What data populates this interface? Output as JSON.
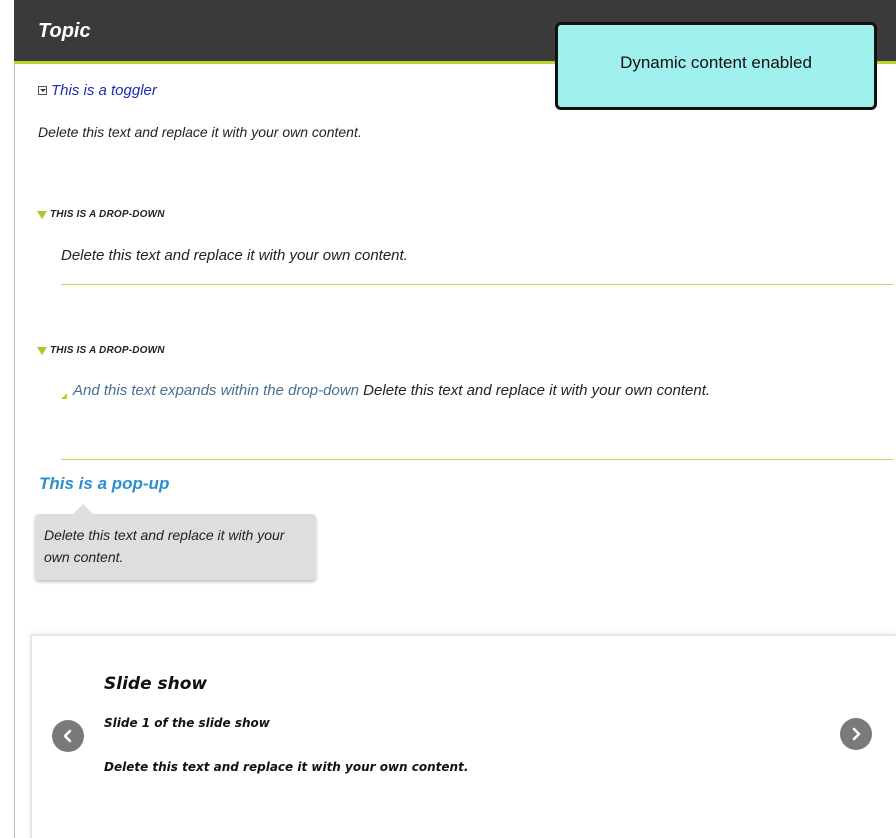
{
  "topic": {
    "title": "Topic"
  },
  "callout": {
    "text": "Dynamic content enabled"
  },
  "toggler": {
    "label": "This is a toggler",
    "icon": "toggle-expand-icon"
  },
  "intro_text": "Delete this text and replace it with your own content.",
  "dropdowns": [
    {
      "label": "THIS IS A DROP-DOWN",
      "body": "Delete this text and replace it with your own content."
    },
    {
      "label": "THIS IS A DROP-DOWN",
      "expand_link": "And this text expands within the drop-down",
      "expand_body": " Delete this text and replace it with your own content."
    }
  ],
  "popup": {
    "link": "This is a pop-up",
    "text": "Delete this text and replace it with your own content."
  },
  "slideshow": {
    "title": "Slide show",
    "subtitle": "Slide 1 of the slide show",
    "body": "Delete this text and replace it with your own content.",
    "prev_icon": "chevron-left-icon",
    "next_icon": "chevron-right-icon"
  },
  "colors": {
    "header_bg": "#3a3a3a",
    "accent_green": "#b7d431",
    "callout_bg": "#a0f0ee",
    "toggler_text": "#1e2bb0",
    "popup_link": "#2b8fcf",
    "expand_link": "#4a6f91"
  }
}
